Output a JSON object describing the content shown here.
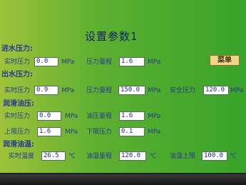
{
  "title": "设置参数1",
  "menu_label": "菜单",
  "sections": {
    "inlet": "进水压力:",
    "outlet": "出水压力:",
    "lube_pressure": "润滑油压:",
    "lube_temp": "润滑油温:"
  },
  "inlet": {
    "actual_label": "实时压力",
    "actual_value": "0.0",
    "actual_unit": "MPa",
    "range_label": "压力量程",
    "range_value": "1.6",
    "range_unit": "MPa"
  },
  "outlet": {
    "actual_label": "实时压力",
    "actual_value": "0.9",
    "actual_unit": "MPa",
    "range_label": "压力量程",
    "range_value": "150.0",
    "range_unit": "MPa",
    "safe_label": "安全压力",
    "safe_value": "120.0",
    "safe_unit": "MPa"
  },
  "lube_pressure": {
    "actual_label": "实时压力",
    "actual_value": "0.0",
    "actual_unit": "MPa",
    "range_label": "油压量程",
    "range_value": "1.6",
    "range_unit": "MPa",
    "upper_label": "上限压力",
    "upper_value": "1.6",
    "upper_unit": "MPa",
    "lower_label": "下限压力",
    "lower_value": "0.1",
    "lower_unit": "MPa"
  },
  "lube_temp": {
    "actual_label": "实时温度",
    "actual_value": "26.5",
    "actual_unit": "℃",
    "range_label": "油温量程",
    "range_value": "120.0",
    "range_unit": "℃",
    "upper_label": "油温上限",
    "upper_value": "100.0",
    "upper_unit": "℃"
  }
}
